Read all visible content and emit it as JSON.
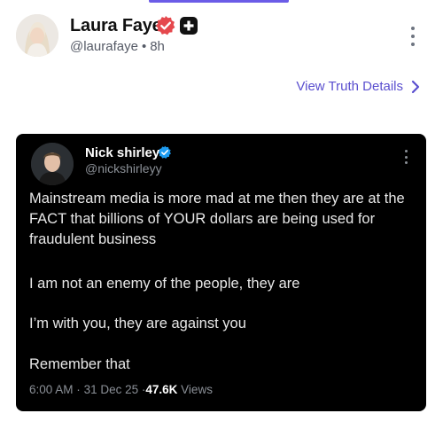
{
  "post": {
    "author": {
      "display_name": "Laura Faye",
      "handle": "@laurafaye",
      "separator": "•",
      "time": "8h",
      "badges": [
        "verified-badge-icon",
        "plus-badge-icon"
      ]
    },
    "view_details_label": "View Truth Details",
    "more_icon": "vertical-dots-icon"
  },
  "embed": {
    "author": {
      "display_name": "Nick shirley",
      "handle": "@nickshirleyy",
      "badge": "blue-check-icon"
    },
    "paragraphs": [
      "Mainstream media is more mad at me then they are at the FACT that billions of YOUR dollars are being used for fraudulent business",
      "I am not an enemy of the people, they are",
      "I’m with you, they are against you",
      "Remember that"
    ],
    "meta": {
      "time": "6:00 AM",
      "sep1": "·",
      "date": "31 Dec 25",
      "sep2": "·",
      "views": "47.6K",
      "views_label": "Views"
    }
  },
  "colors": {
    "accent": "#5a4fcf",
    "verified_red": "#e5484d",
    "card_bg": "#000000",
    "blue_check": "#1d9bf0"
  }
}
